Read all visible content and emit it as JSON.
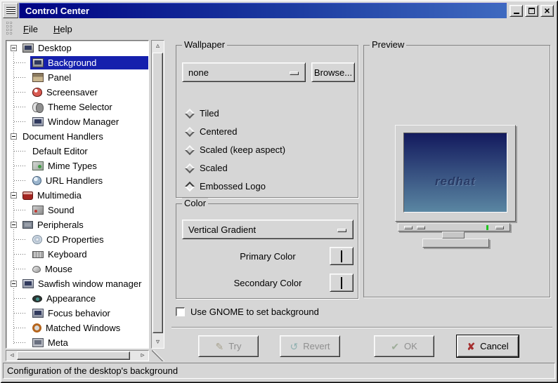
{
  "window": {
    "title": "Control Center",
    "controls": [
      "minimize",
      "maximize",
      "close"
    ]
  },
  "menu": {
    "items": [
      {
        "label": "File"
      },
      {
        "label": "Help"
      }
    ]
  },
  "sidebar": {
    "items": [
      {
        "label": "Desktop",
        "level": 0,
        "expander": true,
        "icon": "desktop-icon",
        "selected": false
      },
      {
        "label": "Background",
        "level": 1,
        "icon": "background-monitor-icon",
        "selected": true
      },
      {
        "label": "Panel",
        "level": 1,
        "icon": "panel-icon",
        "selected": false
      },
      {
        "label": "Screensaver",
        "level": 1,
        "icon": "screensaver-icon",
        "selected": false
      },
      {
        "label": "Theme Selector",
        "level": 1,
        "icon": "theme-selector-icon",
        "selected": false
      },
      {
        "label": "Window Manager",
        "level": 1,
        "icon": "window-manager-icon",
        "selected": false
      },
      {
        "label": "Document Handlers",
        "level": 0,
        "expander": true,
        "icon": null,
        "selected": false
      },
      {
        "label": "Default Editor",
        "level": 1,
        "icon": null,
        "selected": false
      },
      {
        "label": "Mime Types",
        "level": 1,
        "icon": "mime-types-icon",
        "selected": false
      },
      {
        "label": "URL Handlers",
        "level": 1,
        "icon": "url-handlers-icon",
        "selected": false
      },
      {
        "label": "Multimedia",
        "level": 0,
        "expander": true,
        "icon": "multimedia-icon",
        "selected": false
      },
      {
        "label": "Sound",
        "level": 1,
        "icon": "sound-icon",
        "selected": false
      },
      {
        "label": "Peripherals",
        "level": 0,
        "expander": true,
        "icon": "peripherals-icon",
        "selected": false
      },
      {
        "label": "CD Properties",
        "level": 1,
        "icon": "cd-icon",
        "selected": false
      },
      {
        "label": "Keyboard",
        "level": 1,
        "icon": "keyboard-icon",
        "selected": false
      },
      {
        "label": "Mouse",
        "level": 1,
        "icon": "mouse-icon",
        "selected": false
      },
      {
        "label": "Sawfish window manager",
        "level": 0,
        "expander": true,
        "icon": "sawfish-icon",
        "selected": false
      },
      {
        "label": "Appearance",
        "level": 1,
        "icon": "appearance-icon",
        "selected": false
      },
      {
        "label": "Focus behavior",
        "level": 1,
        "icon": "focus-icon",
        "selected": false
      },
      {
        "label": "Matched Windows",
        "level": 1,
        "icon": "matched-windows-icon",
        "selected": false
      },
      {
        "label": "Meta",
        "level": 1,
        "icon": "meta-icon",
        "selected": false
      }
    ],
    "selection_color": "#1520ad"
  },
  "wallpaper": {
    "frame_title": "Wallpaper",
    "file_select": {
      "value": "none"
    },
    "browse_label": "Browse...",
    "layout_options": [
      {
        "label": "Tiled",
        "selected": false
      },
      {
        "label": "Centered",
        "selected": false
      },
      {
        "label": "Scaled (keep aspect)",
        "selected": false
      },
      {
        "label": "Scaled",
        "selected": false
      },
      {
        "label": "Embossed Logo",
        "selected": true
      }
    ]
  },
  "color": {
    "frame_title": "Color",
    "gradient_select": {
      "value": "Vertical Gradient"
    },
    "primary": {
      "label": "Primary Color",
      "color": "#171c6e"
    },
    "secondary": {
      "label": "Secondary Color",
      "color": "#4f7ba0"
    }
  },
  "preview": {
    "frame_title": "Preview",
    "logo_text": "redhat",
    "screen_top": "#131a5e",
    "screen_bottom": "#5a86a2"
  },
  "gnome_checkbox": {
    "label": "Use GNOME to set background",
    "checked": false
  },
  "actions": [
    {
      "label": "Try",
      "icon": "try-icon",
      "glyph": "✎",
      "enabled": false
    },
    {
      "label": "Revert",
      "icon": "revert-icon",
      "glyph": "↺",
      "enabled": false
    },
    {
      "label": "OK",
      "icon": "ok-icon",
      "glyph": "✔",
      "enabled": false
    },
    {
      "label": "Cancel",
      "icon": "cancel-icon",
      "glyph": "✘",
      "enabled": true
    }
  ],
  "statusbar": {
    "text": "Configuration of the desktop's background"
  }
}
